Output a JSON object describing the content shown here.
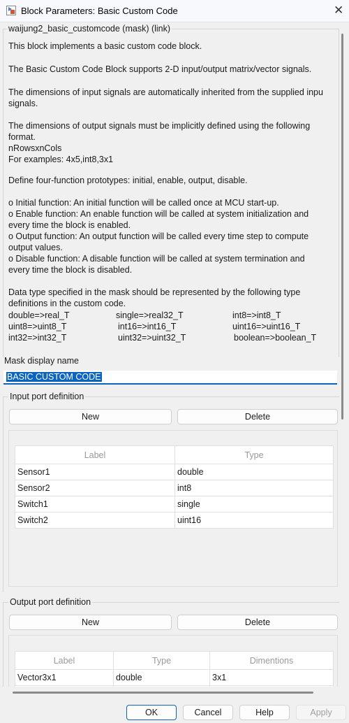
{
  "window": {
    "title": "Block Parameters: Basic Custom Code"
  },
  "mask": {
    "legend": "waijung2_basic_customcode (mask) (link)",
    "lines": [
      "This block implements a basic custom code block.",
      "The Basic Custom Code Block supports 2-D input/output matrix/vector signals.",
      "The dimensions of input signals are automatically inherited from the supplied inpu",
      "signals.",
      "The dimensions of output signals must be implicitly defined using the following",
      "format.",
      "nRowsxnCols",
      "For examples: 4x5,int8,3x1",
      "Define four-function prototypes: initial, enable, output, disable.",
      "o Initial function: An initial function will be called once at MCU start-up.",
      "o Enable function: An enable function will be called at system initialization and",
      "every time the block is enabled.",
      "o Output function: An output function will be called every time step to compute",
      "output values.",
      "o Disable function: A disable function will be called at system termination and",
      "every time the block is disabled.",
      "Data type specified in the mask should be represented by the following type",
      "definitions in the custom code."
    ],
    "type_map": [
      [
        "double=>real_T",
        "single=>real32_T",
        "int8=>int8_T"
      ],
      [
        "uint8=>uint8_T",
        "int16=>int16_T",
        "uint16=>uint16_T"
      ],
      [
        "int32=>int32_T",
        "uint32=>uint32_T",
        "boolean=>boolean_T"
      ]
    ]
  },
  "display_name": {
    "label": "Mask display name",
    "value": "BASIC CUSTOM CODE"
  },
  "input_ports": {
    "legend": "Input port definition",
    "new": "New",
    "delete": "Delete",
    "headers": [
      "Label",
      "Type"
    ],
    "rows": [
      [
        "Sensor1",
        "double"
      ],
      [
        "Sensor2",
        "int8"
      ],
      [
        "Switch1",
        "single"
      ],
      [
        "Switch2",
        "uint16"
      ]
    ]
  },
  "output_ports": {
    "legend": "Output port definition",
    "new": "New",
    "delete": "Delete",
    "headers": [
      "Label",
      "Type",
      "Dimentions"
    ],
    "rows": [
      [
        "Vector3x1",
        "double",
        "3x1"
      ]
    ]
  },
  "footer": {
    "ok": "OK",
    "cancel": "Cancel",
    "help": "Help",
    "apply": "Apply"
  }
}
